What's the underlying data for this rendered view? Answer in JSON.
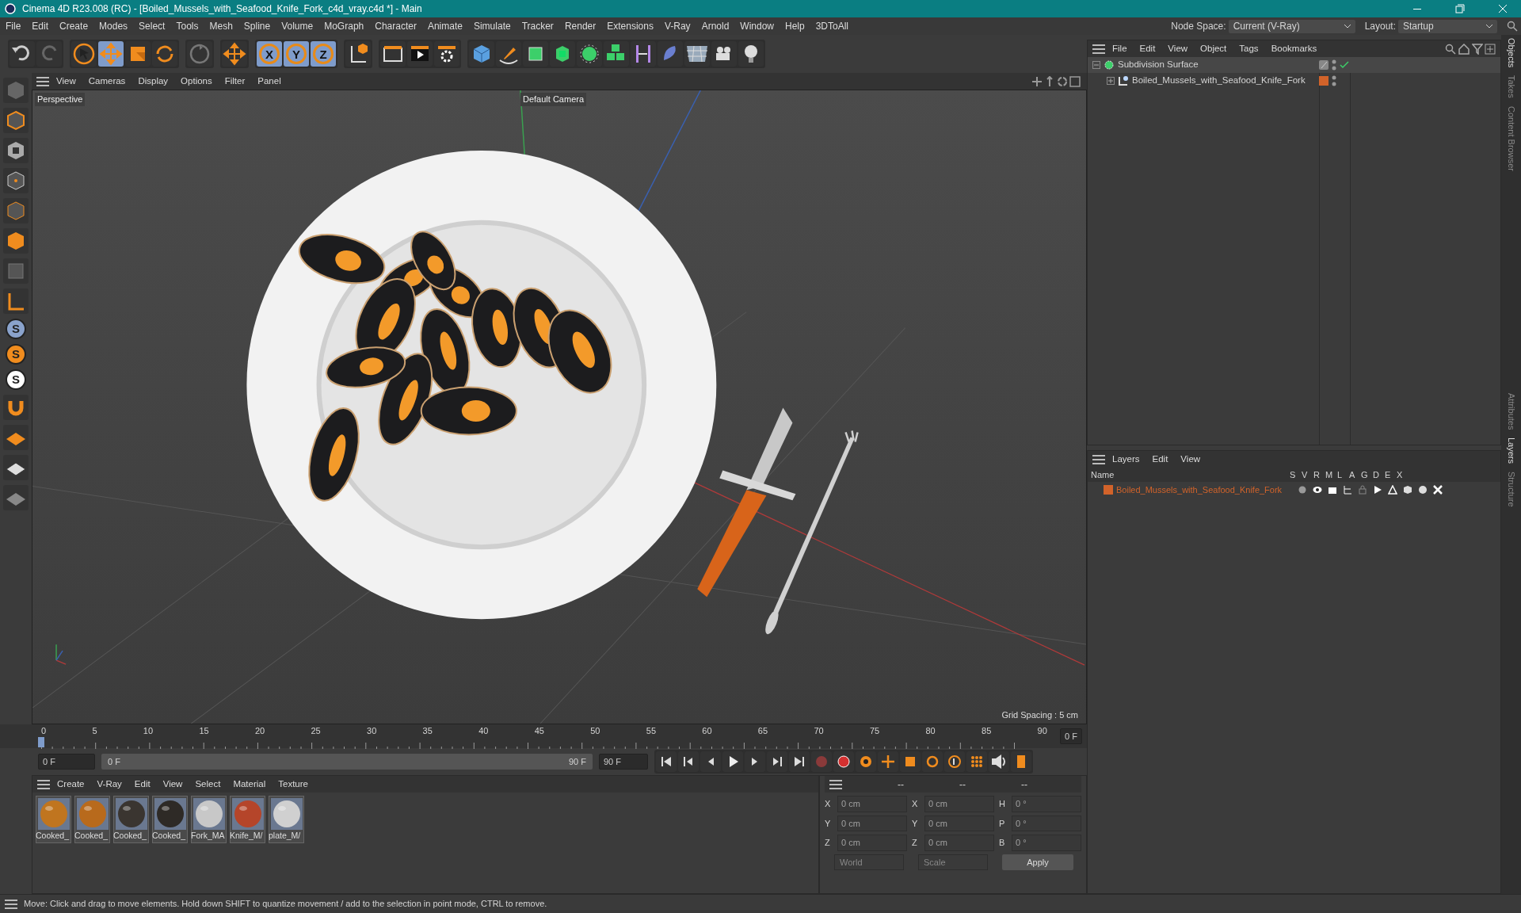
{
  "window": {
    "title": "Cinema 4D R23.008 (RC) - [Boiled_Mussels_with_Seafood_Knife_Fork_c4d_vray.c4d *] - Main"
  },
  "menu_bar": [
    "File",
    "Edit",
    "Create",
    "Modes",
    "Select",
    "Tools",
    "Mesh",
    "Spline",
    "Volume",
    "MoGraph",
    "Character",
    "Animate",
    "Simulate",
    "Tracker",
    "Render",
    "Extensions",
    "V-Ray",
    "Arnold",
    "Window",
    "Help",
    "3DToAll"
  ],
  "node_space": {
    "label": "Node Space:",
    "value": "Current (V-Ray)"
  },
  "layout": {
    "label": "Layout:",
    "value": "Startup"
  },
  "axis_buttons": [
    {
      "label": "X",
      "selected": true
    },
    {
      "label": "Y",
      "selected": true
    },
    {
      "label": "Z",
      "selected": true
    }
  ],
  "snap_buttons": [
    "S",
    "S",
    "S"
  ],
  "viewport": {
    "menu": [
      "View",
      "Cameras",
      "Display",
      "Options",
      "Filter",
      "Panel"
    ],
    "view_name": "Perspective",
    "camera": "Default Camera",
    "grid_spacing": "Grid Spacing : 5 cm"
  },
  "timeline": {
    "ticks": [
      "0",
      "5",
      "10",
      "15",
      "20",
      "25",
      "30",
      "35",
      "40",
      "45",
      "50",
      "55",
      "60",
      "65",
      "70",
      "75",
      "80",
      "85",
      "90"
    ],
    "current_frame": "0 F",
    "start": "0 F",
    "range_start": "0 F",
    "range_end": "90 F",
    "end": "90 F"
  },
  "materials": {
    "menu": [
      "Create",
      "V-Ray",
      "Edit",
      "View",
      "Select",
      "Material",
      "Texture"
    ],
    "items": [
      {
        "name": "Cooked_",
        "color": "#c0751f"
      },
      {
        "name": "Cooked_",
        "color": "#b86a1c"
      },
      {
        "name": "Cooked_",
        "color": "#3a3530"
      },
      {
        "name": "Cooked_",
        "color": "#2e2a26"
      },
      {
        "name": "Fork_MA",
        "color": "#c8c8c8"
      },
      {
        "name": "Knife_M/",
        "color": "#b5452a"
      },
      {
        "name": "plate_M/",
        "color": "#d0d0d0"
      }
    ]
  },
  "coordinates": {
    "headers": [
      "--",
      "--",
      "--"
    ],
    "rows": [
      [
        {
          "axis": "X",
          "value": "0 cm"
        },
        {
          "axis": "X",
          "value": "0 cm"
        },
        {
          "axis": "H",
          "value": "0 °"
        }
      ],
      [
        {
          "axis": "Y",
          "value": "0 cm"
        },
        {
          "axis": "Y",
          "value": "0 cm"
        },
        {
          "axis": "P",
          "value": "0 °"
        }
      ],
      [
        {
          "axis": "Z",
          "value": "0 cm"
        },
        {
          "axis": "Z",
          "value": "0 cm"
        },
        {
          "axis": "B",
          "value": "0 °"
        }
      ]
    ],
    "space": "World",
    "mode": "Scale",
    "apply": "Apply"
  },
  "objects": {
    "menu": [
      "File",
      "Edit",
      "View",
      "Object",
      "Tags",
      "Bookmarks"
    ],
    "tree": [
      {
        "name": "Subdivision Surface",
        "selected": true,
        "expanded": true,
        "children": [
          {
            "name": "Boiled_Mussels_with_Seafood_Knife_Fork",
            "selected": false,
            "expanded": false,
            "color": "#d2632a"
          }
        ]
      }
    ]
  },
  "layers": {
    "menu": [
      "Layers",
      "Edit",
      "View"
    ],
    "columns": [
      "Name",
      "S",
      "V",
      "R",
      "M",
      "L",
      "A",
      "G",
      "D",
      "E",
      "X"
    ],
    "rows": [
      {
        "name": "Boiled_Mussels_with_Seafood_Knife_Fork",
        "color": "#d2632a"
      }
    ]
  },
  "side_tabs": [
    {
      "label": "Objects",
      "selected": true
    },
    {
      "label": "Takes",
      "selected": false
    },
    {
      "label": "Content Browser",
      "selected": false
    },
    {
      "label": "Attributes",
      "selected": false
    },
    {
      "label": "Layers",
      "selected": true
    },
    {
      "label": "Structure",
      "selected": false
    }
  ],
  "status_bar": "Move: Click and drag to move elements. Hold down SHIFT to quantize movement / add to the selection in point mode, CTRL to remove."
}
